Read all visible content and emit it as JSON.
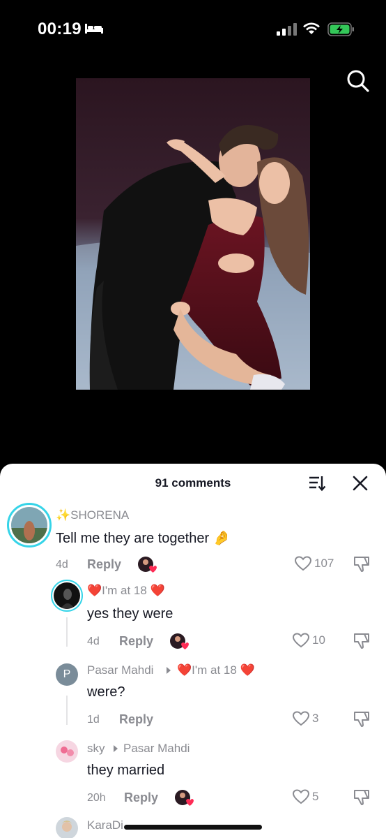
{
  "status_bar": {
    "time": "00:19",
    "icons": [
      "bed-icon",
      "cellular-signal-icon",
      "wifi-icon",
      "battery-charging-icon"
    ],
    "battery_color": "#34c759"
  },
  "top_bar": {
    "icons": [
      "search-icon"
    ]
  },
  "comments": {
    "count_label": "91 comments",
    "items": [
      {
        "username": "✨SHORENA",
        "text": "Tell me they are together 🤌",
        "time": "4d",
        "reply_label": "Reply",
        "likes": "107"
      },
      {
        "username": "❤️I'm at 18 ❤️",
        "text": "yes they were",
        "time": "4d",
        "reply_label": "Reply",
        "likes": "10"
      },
      {
        "username": "Pasar Mahdi",
        "reply_to": "❤️I'm at 18 ❤️",
        "avatar_letter": "P",
        "text": "were?",
        "time": "1d",
        "reply_label": "Reply",
        "likes": "3"
      },
      {
        "username": "sky",
        "reply_to": "Pasar Mahdi",
        "text": "they married",
        "time": "20h",
        "reply_label": "Reply",
        "likes": "5"
      },
      {
        "username": "KaraDi"
      }
    ]
  },
  "colors": {
    "accent_ring": "#36d4e8",
    "text_primary": "#161823",
    "text_secondary": "#8a8b91",
    "heart_red": "#fe2c55"
  }
}
